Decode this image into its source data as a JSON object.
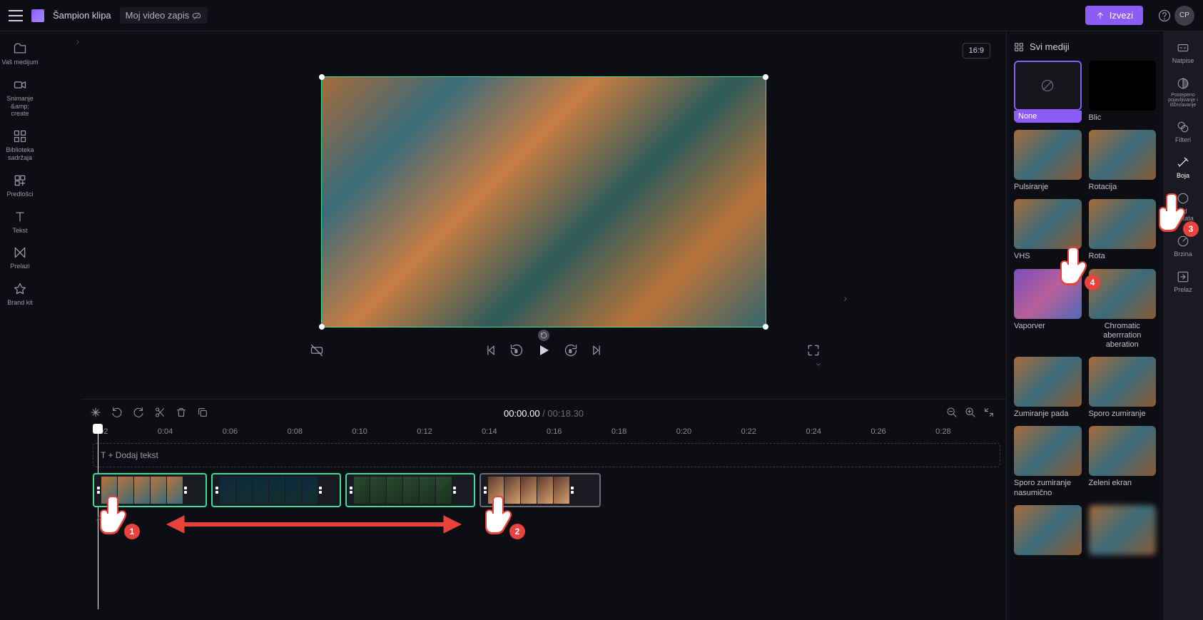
{
  "header": {
    "app_name": "Šampion klipa",
    "project_name": "Moj video zapis",
    "export_label": "Izvezi",
    "avatar": "CP"
  },
  "left_sidebar": {
    "items": [
      "Vaš medijum",
      "Snimanje &amp;\ncreate",
      "Biblioteka\nsadržaja",
      "Predlošci",
      "Tekst",
      "Prelazi",
      "Brand kit"
    ]
  },
  "preview": {
    "aspect": "16:9"
  },
  "time": {
    "current": "00:00.00",
    "total": "00:18.30"
  },
  "ruler": [
    "0:02",
    "0:04",
    "0:06",
    "0:08",
    "0:10",
    "0:12",
    "0:14",
    "0:16",
    "0:18",
    "0:20",
    "0:22",
    "0:24",
    "0:26",
    "0:28"
  ],
  "tracks": {
    "text_track_label": "T + Dodaj tekst",
    "audio_track_label": "♫  + A"
  },
  "effects": {
    "panel_title": "Svi mediji",
    "items": [
      {
        "label": "None",
        "variant": "selected"
      },
      {
        "label": "Blic",
        "variant": "black"
      },
      {
        "label": "Pulsiranje",
        "variant": ""
      },
      {
        "label": "Rotacija",
        "variant": ""
      },
      {
        "label": "VHS",
        "variant": ""
      },
      {
        "label": "Rota",
        "variant": ""
      },
      {
        "label": "Vaporver",
        "variant": "vapor"
      },
      {
        "label": "Chromatic aberrration aberation",
        "variant": "",
        "center": true
      },
      {
        "label": "Zumiranje pada",
        "variant": ""
      },
      {
        "label": "Sporo zumiranje",
        "variant": ""
      },
      {
        "label": "Sporo zumiranje nasumično",
        "variant": ""
      },
      {
        "label": "Zeleni ekran",
        "variant": ""
      },
      {
        "label": "",
        "variant": ""
      },
      {
        "label": "",
        "variant": "blur"
      }
    ]
  },
  "right_rail": {
    "items": [
      "Natpise",
      "Postepeno pojavljivanje i iščezavanje",
      "Filteri",
      "Boja",
      "Ad\nefekata",
      "Brzina",
      "Prelaz"
    ]
  },
  "hands": {
    "1": "1",
    "2": "2",
    "3": "3",
    "4": "4"
  }
}
